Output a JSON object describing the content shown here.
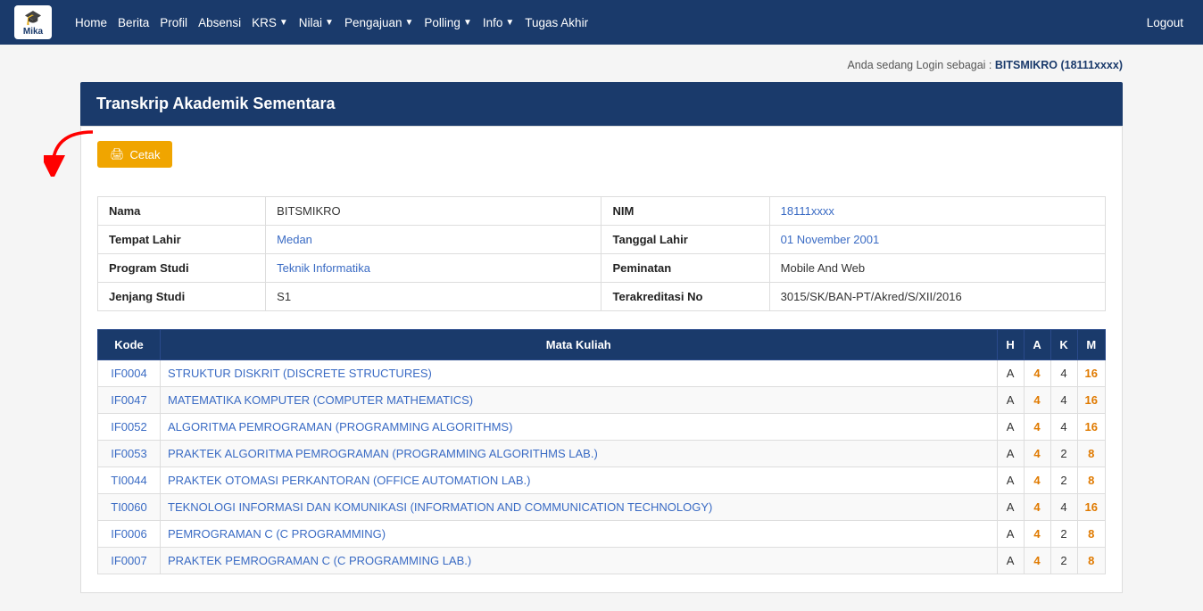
{
  "nav": {
    "logo_text": "Mika",
    "items": [
      {
        "label": "Home",
        "has_dropdown": false
      },
      {
        "label": "Berita",
        "has_dropdown": false
      },
      {
        "label": "Profil",
        "has_dropdown": false
      },
      {
        "label": "Absensi",
        "has_dropdown": false
      },
      {
        "label": "KRS",
        "has_dropdown": true
      },
      {
        "label": "Nilai",
        "has_dropdown": true
      },
      {
        "label": "Pengajuan",
        "has_dropdown": true
      },
      {
        "label": "Polling",
        "has_dropdown": true
      },
      {
        "label": "Info",
        "has_dropdown": true
      },
      {
        "label": "Tugas Akhir",
        "has_dropdown": false
      },
      {
        "label": "Logout",
        "has_dropdown": false,
        "is_logout": true
      }
    ]
  },
  "login_status": {
    "prefix": "Anda sedang Login sebagai : ",
    "user": "BITSMIKRO (18111xxxx)"
  },
  "page_title": "Transkrip Akademik Sementara",
  "cetak_label": "Cetak",
  "student_info": {
    "rows": [
      {
        "label1": "Nama",
        "val1": "BITSMIKRO",
        "label2": "NIM",
        "val2": "18111xxxx",
        "val2_link": true
      },
      {
        "label1": "Tempat Lahir",
        "val1": "Medan",
        "val1_link": true,
        "label2": "Tanggal Lahir",
        "val2": "01 November 2001",
        "val2_link": true
      },
      {
        "label1": "Program Studi",
        "val1": "Teknik Informatika",
        "val1_link": true,
        "label2": "Peminatan",
        "val2": "Mobile And Web",
        "val2_link": false
      },
      {
        "label1": "Jenjang Studi",
        "val1": "S1",
        "val1_link": false,
        "label2": "Terakreditasi No",
        "val2": "3015/SK/BAN-PT/Akred/S/XII/2016",
        "val2_link": false
      }
    ]
  },
  "grades_table": {
    "headers": [
      "Kode",
      "Mata Kuliah",
      "H",
      "A",
      "K",
      "M"
    ],
    "rows": [
      {
        "kode": "IF0004",
        "mata": "STRUKTUR DISKRIT (DISCRETE STRUCTURES)",
        "h": "A",
        "a": "4",
        "k": "4",
        "m": "16"
      },
      {
        "kode": "IF0047",
        "mata": "MATEMATIKA KOMPUTER (COMPUTER MATHEMATICS)",
        "h": "A",
        "a": "4",
        "k": "4",
        "m": "16"
      },
      {
        "kode": "IF0052",
        "mata": "ALGORITMA PEMROGRAMAN (PROGRAMMING ALGORITHMS)",
        "h": "A",
        "a": "4",
        "k": "4",
        "m": "16"
      },
      {
        "kode": "IF0053",
        "mata": "PRAKTEK ALGORITMA PEMROGRAMAN (PROGRAMMING ALGORITHMS LAB.)",
        "h": "A",
        "a": "4",
        "k": "2",
        "m": "8"
      },
      {
        "kode": "TI0044",
        "mata": "PRAKTEK OTOMASI PERKANTORAN (OFFICE AUTOMATION LAB.)",
        "h": "A",
        "a": "4",
        "k": "2",
        "m": "8"
      },
      {
        "kode": "TI0060",
        "mata": "TEKNOLOGI INFORMASI DAN KOMUNIKASI (INFORMATION AND COMMUNICATION TECHNOLOGY)",
        "h": "A",
        "a": "4",
        "k": "4",
        "m": "16"
      },
      {
        "kode": "IF0006",
        "mata": "PEMROGRAMAN C (C PROGRAMMING)",
        "h": "A",
        "a": "4",
        "k": "2",
        "m": "8"
      },
      {
        "kode": "IF0007",
        "mata": "PRAKTEK PEMROGRAMAN C (C PROGRAMMING LAB.)",
        "h": "A",
        "a": "4",
        "k": "2",
        "m": "8"
      }
    ]
  },
  "colors": {
    "nav_bg": "#1a3a6b",
    "accent_orange": "#f0a500",
    "link_blue": "#3a6bc4"
  }
}
